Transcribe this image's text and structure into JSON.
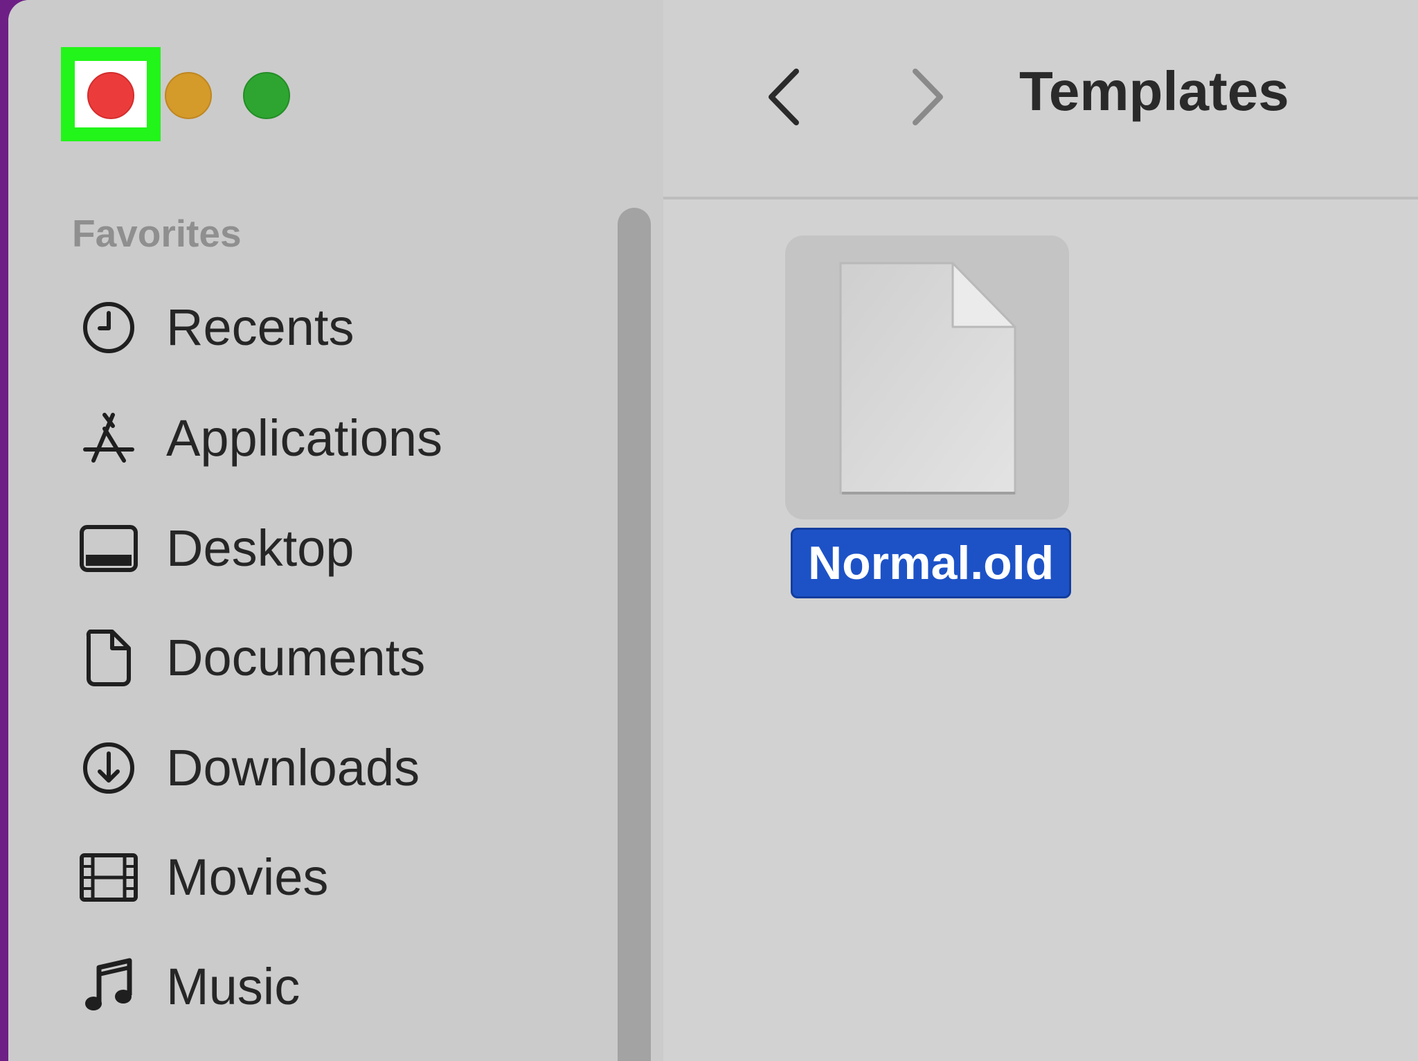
{
  "window": {
    "title": "Templates",
    "traffic_lights": {
      "close_color": "#ec3b3b",
      "minimize_color": "#d49a2a",
      "zoom_color": "#2ea531",
      "highlight_color": "#22f51a"
    }
  },
  "sidebar": {
    "section_title": "Favorites",
    "items": [
      {
        "label": "Recents",
        "icon": "clock-icon"
      },
      {
        "label": "Applications",
        "icon": "applications-icon"
      },
      {
        "label": "Desktop",
        "icon": "desktop-icon"
      },
      {
        "label": "Documents",
        "icon": "document-icon"
      },
      {
        "label": "Downloads",
        "icon": "download-icon"
      },
      {
        "label": "Movies",
        "icon": "film-icon"
      },
      {
        "label": "Music",
        "icon": "music-note-icon"
      }
    ]
  },
  "toolbar": {
    "back_icon": "chevron-left-icon",
    "forward_icon": "chevron-right-icon"
  },
  "files": [
    {
      "name": "Normal.old",
      "icon": "generic-document-icon",
      "selected": true
    }
  ],
  "colors": {
    "selection": "#1d52c7",
    "desktop_background": "#6e1f86"
  }
}
